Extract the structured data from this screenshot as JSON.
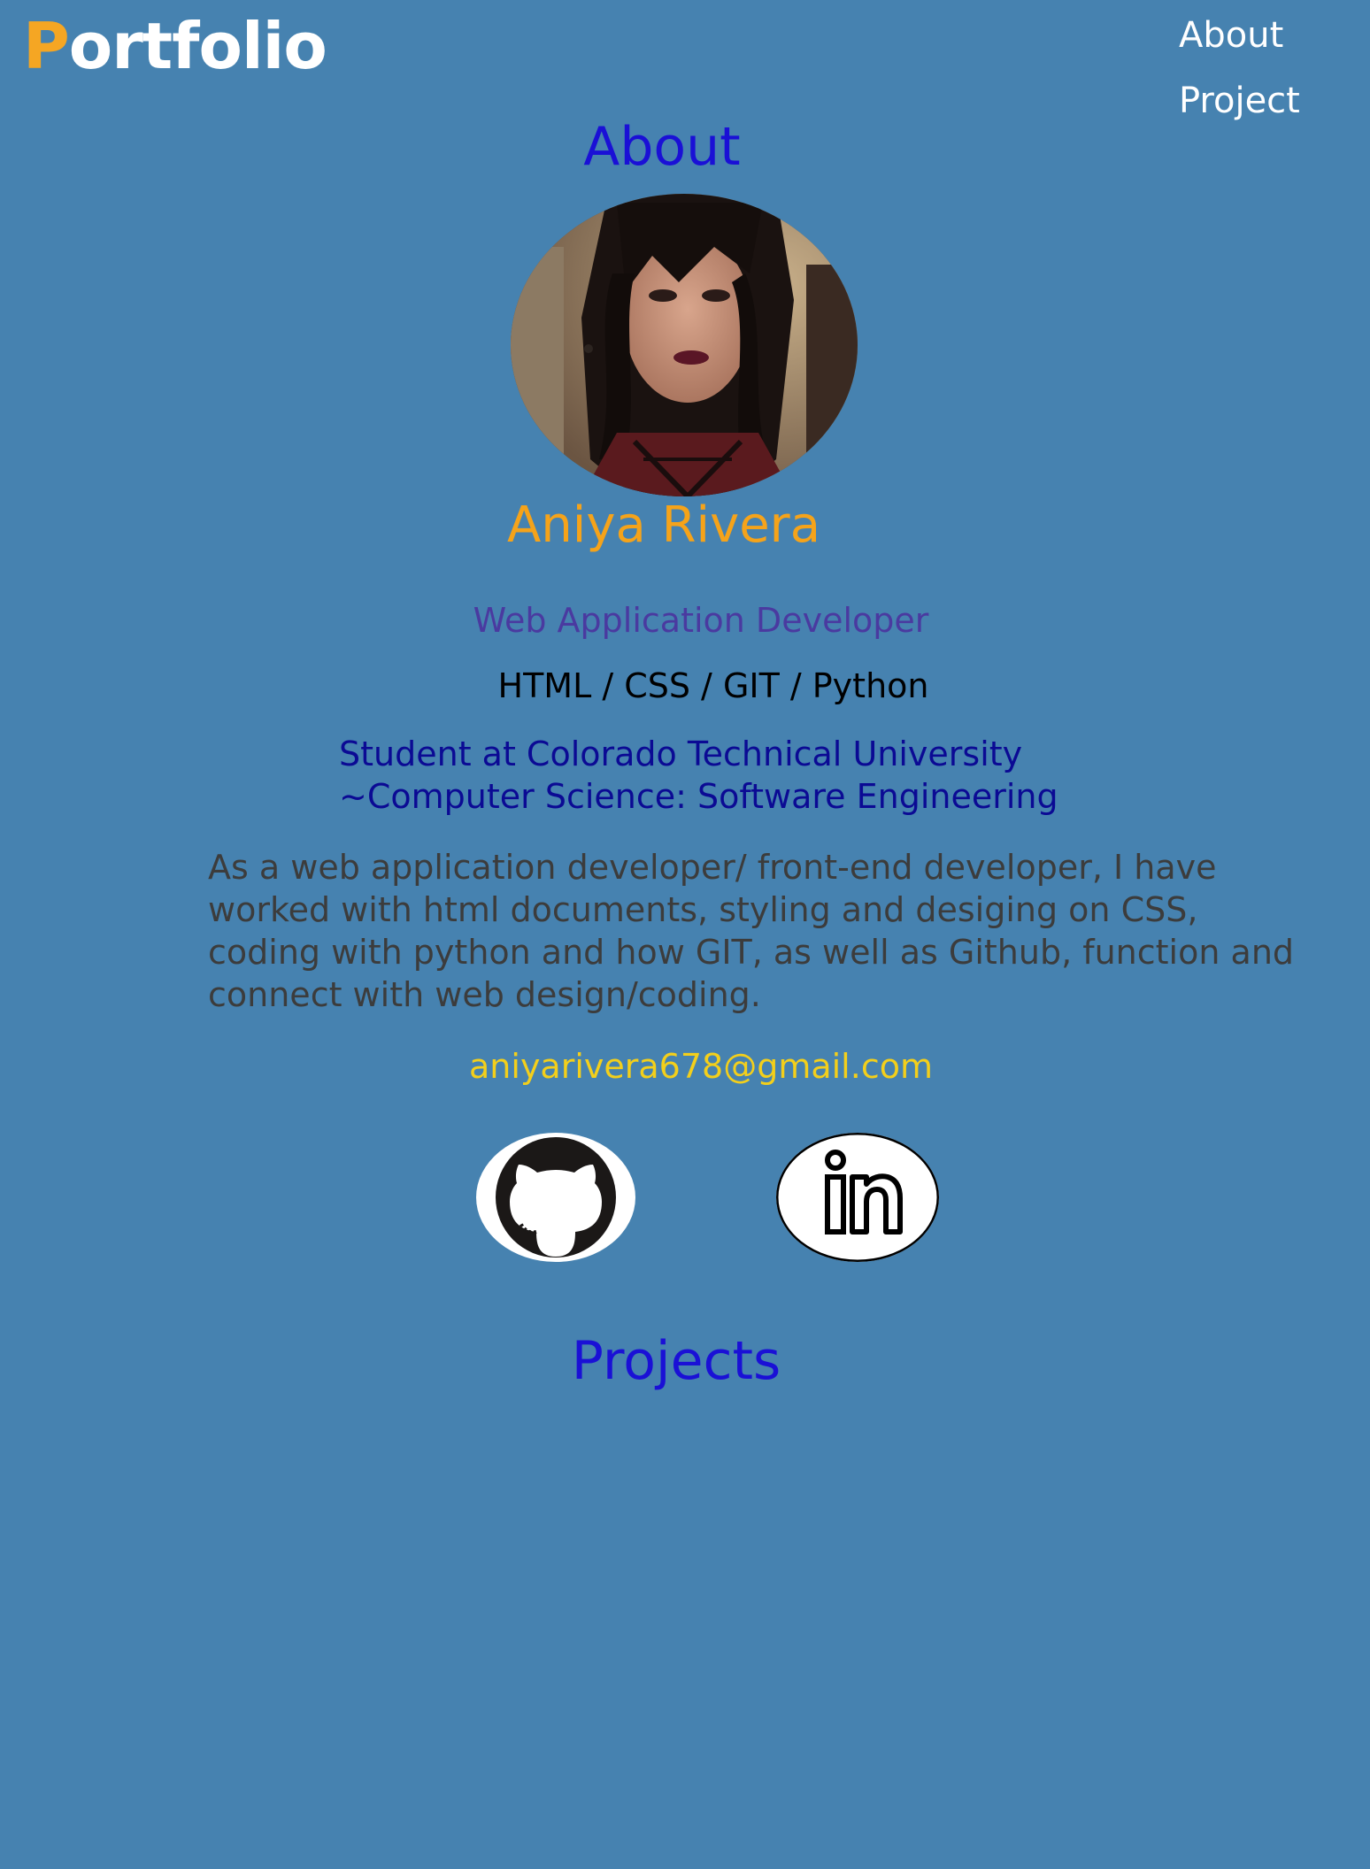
{
  "header": {
    "logo_initial": "P",
    "logo_rest": "ortfolio"
  },
  "nav": {
    "items": [
      {
        "label": "About"
      },
      {
        "label": "Project"
      }
    ]
  },
  "about": {
    "title": "About",
    "name": "Aniya Rivera",
    "role": "Web Application Developer",
    "skills": "HTML / CSS / GIT / Python",
    "school_line1": "Student at Colorado Technical University",
    "school_line2": "~Computer Science: Software Engineering",
    "bio": "As a web application developer/ front-end developer, I have worked  with html documents, styling and desiging on CSS, coding with python and how GIT, as well as Github, function and connect with web design/coding.",
    "email": "aniyarivera678@gmail.com",
    "social": [
      {
        "icon": "github-icon"
      },
      {
        "icon": "linkedin-icon"
      }
    ]
  },
  "projects": {
    "title": "Projects"
  },
  "colors": {
    "background": "#4682b0",
    "logo_accent": "#f5a623",
    "heading": "#1a10d6",
    "name": "#f5a31a",
    "role": "#4a3aa0",
    "school": "#0b0a94",
    "bio": "#3c3c3c",
    "email": "#f3cf1b"
  }
}
